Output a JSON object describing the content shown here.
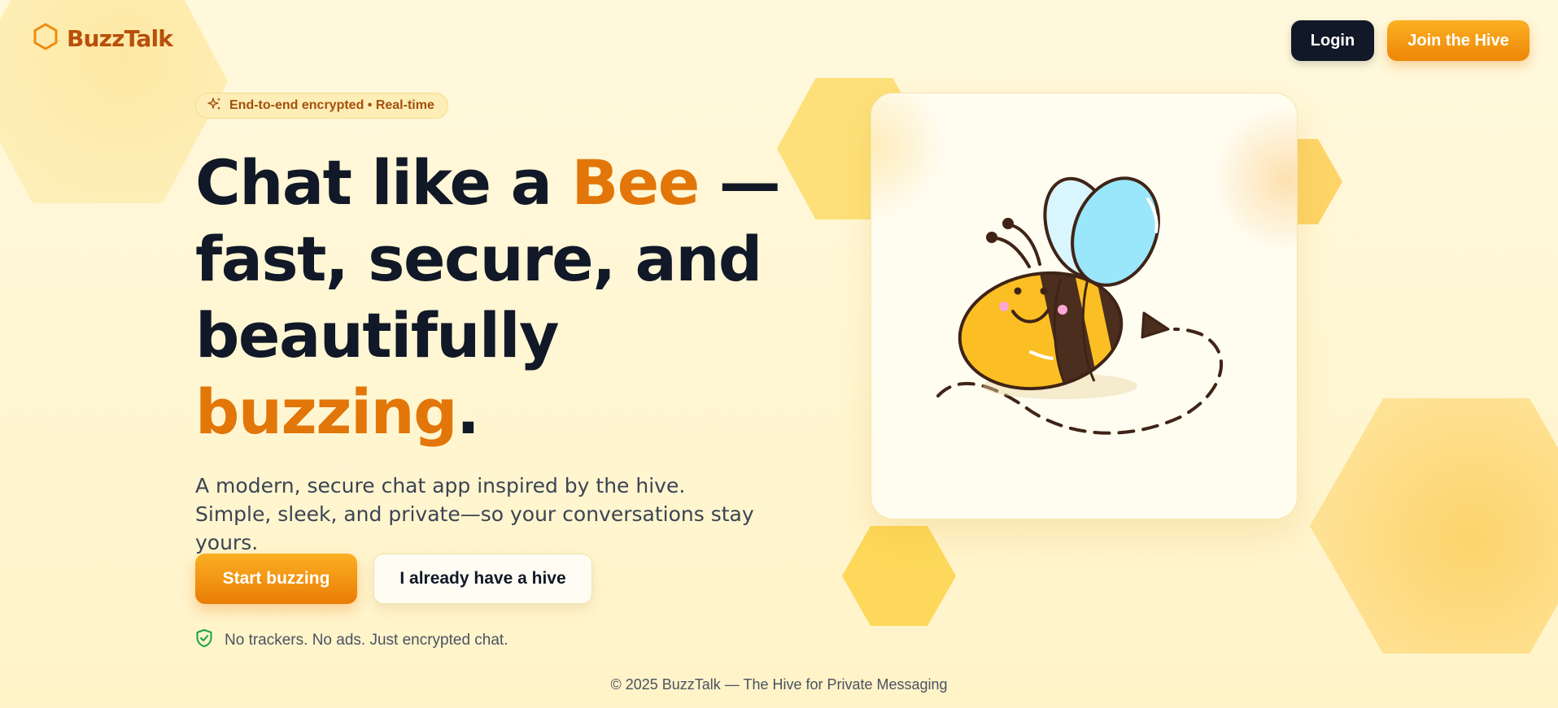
{
  "brand": {
    "name": "BuzzTalk"
  },
  "header": {
    "login_label": "Login",
    "join_label": "Join the Hive"
  },
  "hero": {
    "badge": "End-to-end encrypted • Real-time",
    "headline": {
      "part1": "Chat like a ",
      "accent1": "Bee",
      "part2": " — fast, secure, and beautifully ",
      "accent2": "buzzing",
      "part3": "."
    },
    "lead": "A modern, secure chat app inspired by the hive. Simple, sleek, and private—so your conversations stay yours.",
    "cta_primary": "Start buzzing",
    "cta_secondary": "I already have a hive",
    "trust": "No trackers. No ads. Just encrypted chat."
  },
  "footer": {
    "text": "© 2025 BuzzTalk — The Hive for Private Messaging"
  },
  "icons": {
    "logo": "hexagon-icon",
    "badge": "sparkles-icon",
    "trust": "shield-check-icon",
    "illustration": "bee-illustration"
  },
  "colors": {
    "accent": "#e27608",
    "dark": "#111827",
    "brand": "#b84f0a",
    "honey": "#fcd34d",
    "trust_green": "#16a34a"
  }
}
